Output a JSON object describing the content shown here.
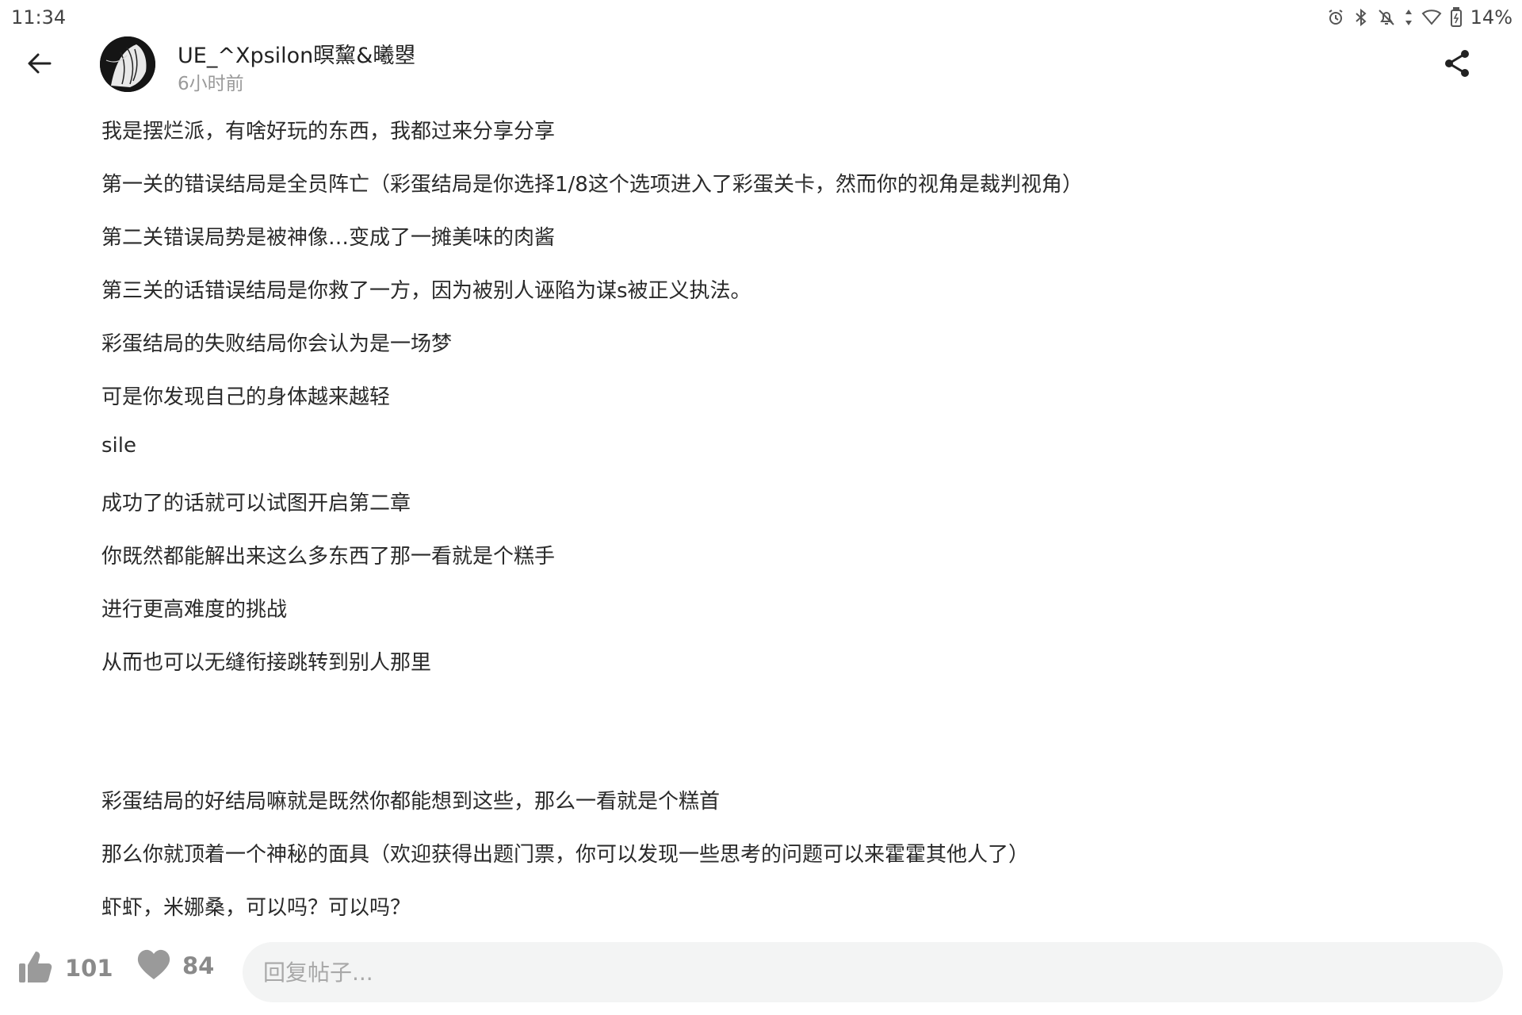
{
  "status_bar": {
    "time": "11:34",
    "battery": "14%",
    "icons": [
      "alarm-icon",
      "bluetooth-icon",
      "notifications-off-icon",
      "data-transfer-icon",
      "wifi-icon",
      "battery-icon"
    ]
  },
  "header": {
    "back_icon": "back-arrow-icon",
    "share_icon": "share-icon",
    "author": {
      "name": "UE_^Xpsilon暝黧&曦曌",
      "time_ago": "6小时前"
    }
  },
  "post": {
    "lines": [
      "我是摆烂派，有啥好玩的东西，我都过来分享分享",
      "第一关的错误结局是全员阵亡（彩蛋结局是你选择1/8这个选项进入了彩蛋关卡，然而你的视角是裁判视角）",
      "第二关错误局势是被神像…变成了一摊美味的肉酱",
      "第三关的话错误结局是你救了一方，因为被别人诬陷为谋s被正义执法。",
      "彩蛋结局的失败结局你会认为是一场梦",
      "可是你发现自己的身体越来越轻",
      "sile",
      "成功了的话就可以试图开启第二章",
      "你既然都能解出来这么多东西了那一看就是个糕手",
      "进行更高难度的挑战",
      "从而也可以无缝衔接跳转到别人那里",
      "",
      "彩蛋结局的好结局嘛就是既然你都能想到这些，那么一看就是个糕首",
      "那么你就顶着一个神秘的面具（欢迎获得出题门票，你可以发现一些思考的问题可以来霍霍其他人了）",
      "虾虾，米娜桑，可以吗？可以吗？"
    ]
  },
  "bottom_bar": {
    "like_icon": "thumbs-up-icon",
    "like_count": "101",
    "favorite_icon": "heart-icon",
    "favorite_count": "84",
    "reply_placeholder": "回复帖子..."
  }
}
